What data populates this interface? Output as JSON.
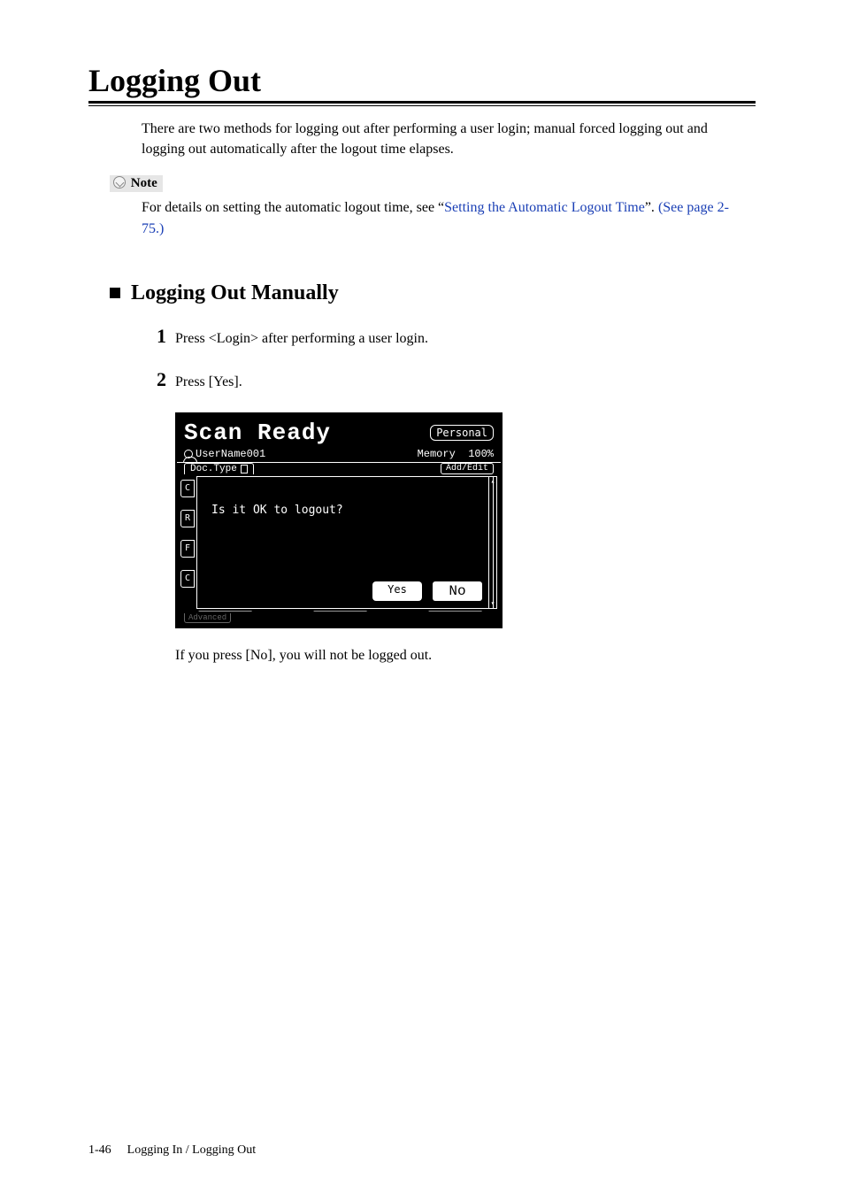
{
  "heading": "Logging Out",
  "intro": "There are two methods for logging out after performing a user login; manual forced logging out and logging out automatically after the logout time elapses.",
  "note": {
    "label": "Note",
    "text_prefix": "For details on setting the automatic logout time, see “",
    "link1": "Setting the Automatic Logout Time",
    "text_mid": "”. ",
    "link2": "(See page 2-75.)"
  },
  "subheading": "Logging Out Manually",
  "steps": {
    "s1": {
      "num": "1",
      "text": "Press <Login> after performing a user login."
    },
    "s2": {
      "num": "2",
      "text": "Press [Yes]."
    }
  },
  "lcd": {
    "title": "Scan Ready",
    "personal": "Personal",
    "user": "UserName001",
    "memory_label": "Memory",
    "memory_value": "100%",
    "doc_type": "Doc.Type",
    "add_edit": "Add/Edit",
    "side": {
      "a": "C",
      "b": "R",
      "c": "F",
      "d": "C"
    },
    "question": "Is it OK to logout?",
    "yes": "Yes",
    "no": "No",
    "advanced": "Advanced"
  },
  "after_lcd": "If you press [No], you will not be logged out.",
  "footer": {
    "page": "1-46",
    "section": "Logging In / Logging Out"
  }
}
